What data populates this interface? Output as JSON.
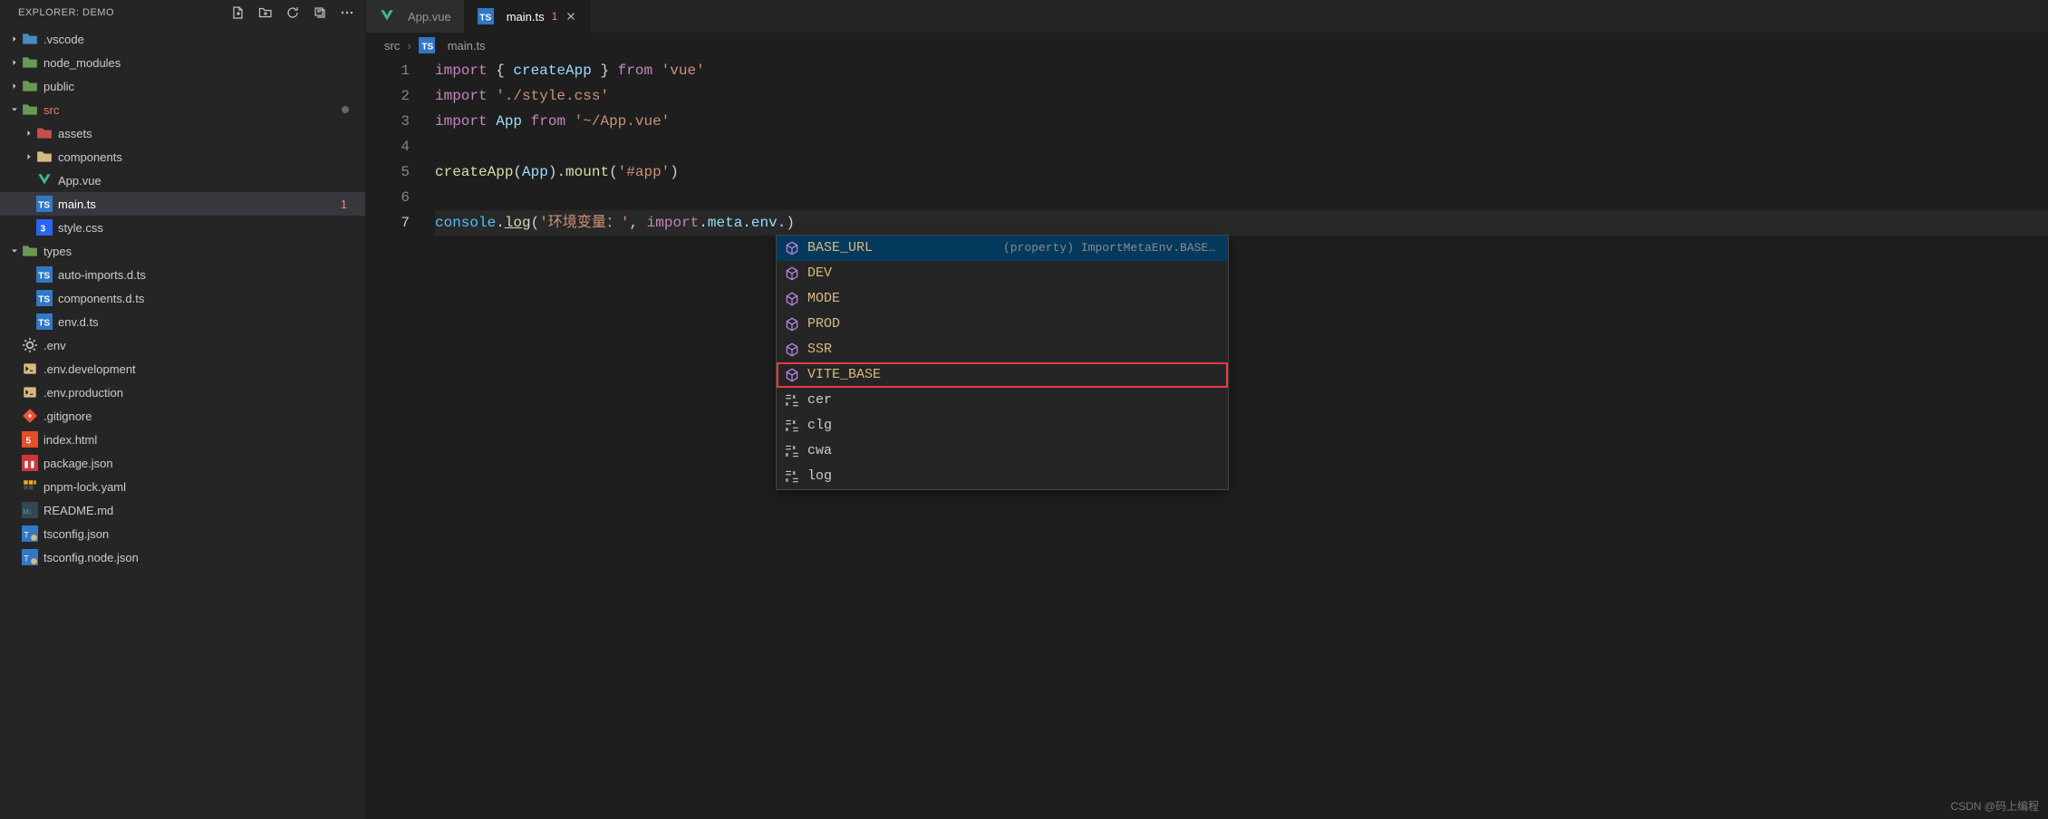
{
  "explorer": {
    "title": "EXPLORER: DEMO",
    "tree": [
      {
        "label": ".vscode",
        "depth": 0,
        "kind": "folder",
        "open": false,
        "icon": "folder-blue"
      },
      {
        "label": "node_modules",
        "depth": 0,
        "kind": "folder",
        "open": false,
        "icon": "folder-green"
      },
      {
        "label": "public",
        "depth": 0,
        "kind": "folder",
        "open": false,
        "icon": "folder-green"
      },
      {
        "label": "src",
        "depth": 0,
        "kind": "folder",
        "open": true,
        "icon": "folder-green",
        "modified": true,
        "cls": "src"
      },
      {
        "label": "assets",
        "depth": 1,
        "kind": "folder",
        "open": false,
        "icon": "folder-red"
      },
      {
        "label": "components",
        "depth": 1,
        "kind": "folder",
        "open": false,
        "icon": "folder-yellow"
      },
      {
        "label": "App.vue",
        "depth": 1,
        "kind": "file",
        "icon": "vue"
      },
      {
        "label": "main.ts",
        "depth": 1,
        "kind": "file",
        "icon": "ts",
        "selected": true,
        "badge": "1"
      },
      {
        "label": "style.css",
        "depth": 1,
        "kind": "file",
        "icon": "css"
      },
      {
        "label": "types",
        "depth": 0,
        "kind": "folder",
        "open": true,
        "icon": "folder-green"
      },
      {
        "label": "auto-imports.d.ts",
        "depth": 1,
        "kind": "file",
        "icon": "ts"
      },
      {
        "label": "components.d.ts",
        "depth": 1,
        "kind": "file",
        "icon": "ts"
      },
      {
        "label": "env.d.ts",
        "depth": 1,
        "kind": "file",
        "icon": "ts"
      },
      {
        "label": ".env",
        "depth": 0,
        "kind": "file",
        "icon": "gear"
      },
      {
        "label": ".env.development",
        "depth": 0,
        "kind": "file",
        "icon": "env"
      },
      {
        "label": ".env.production",
        "depth": 0,
        "kind": "file",
        "icon": "env"
      },
      {
        "label": ".gitignore",
        "depth": 0,
        "kind": "file",
        "icon": "git"
      },
      {
        "label": "index.html",
        "depth": 0,
        "kind": "file",
        "icon": "html"
      },
      {
        "label": "package.json",
        "depth": 0,
        "kind": "file",
        "icon": "npm"
      },
      {
        "label": "pnpm-lock.yaml",
        "depth": 0,
        "kind": "file",
        "icon": "pnpm"
      },
      {
        "label": "README.md",
        "depth": 0,
        "kind": "file",
        "icon": "md"
      },
      {
        "label": "tsconfig.json",
        "depth": 0,
        "kind": "file",
        "icon": "tsconf"
      },
      {
        "label": "tsconfig.node.json",
        "depth": 0,
        "kind": "file",
        "icon": "tsconf"
      }
    ]
  },
  "tabs": [
    {
      "label": "App.vue",
      "icon": "vue",
      "active": false
    },
    {
      "label": "main.ts",
      "icon": "ts",
      "active": true,
      "errors": "1",
      "close": true
    }
  ],
  "breadcrumbs": {
    "seg1": "src",
    "seg2": "main.ts",
    "seg2icon": "ts"
  },
  "code": {
    "lines": [
      {
        "n": "1",
        "tokens": [
          [
            "kw",
            "import"
          ],
          [
            "punc",
            " { "
          ],
          [
            "id",
            "createApp"
          ],
          [
            "punc",
            " } "
          ],
          [
            "kw",
            "from"
          ],
          [
            "punc",
            " "
          ],
          [
            "str",
            "'vue'"
          ]
        ]
      },
      {
        "n": "2",
        "tokens": [
          [
            "kw",
            "import"
          ],
          [
            "punc",
            " "
          ],
          [
            "str",
            "'./style.css'"
          ]
        ]
      },
      {
        "n": "3",
        "tokens": [
          [
            "kw",
            "import"
          ],
          [
            "punc",
            " "
          ],
          [
            "id",
            "App"
          ],
          [
            "punc",
            " "
          ],
          [
            "kw",
            "from"
          ],
          [
            "punc",
            " "
          ],
          [
            "str",
            "'~/App.vue'"
          ]
        ]
      },
      {
        "n": "4",
        "tokens": []
      },
      {
        "n": "5",
        "tokens": [
          [
            "fn",
            "createApp"
          ],
          [
            "punc",
            "("
          ],
          [
            "id",
            "App"
          ],
          [
            "punc",
            ")."
          ],
          [
            "fn",
            "mount"
          ],
          [
            "punc",
            "("
          ],
          [
            "str",
            "'#app'"
          ],
          [
            "punc",
            ")"
          ]
        ]
      },
      {
        "n": "6",
        "tokens": []
      },
      {
        "n": "7",
        "cur": true,
        "tokens": [
          [
            "var",
            "console"
          ],
          [
            "punc",
            "."
          ],
          [
            "log",
            "log"
          ],
          [
            "punc",
            "("
          ],
          [
            "str",
            "'环境变量：'"
          ],
          [
            "punc",
            ", "
          ],
          [
            "kw",
            "import"
          ],
          [
            "punc",
            "."
          ],
          [
            "id",
            "meta"
          ],
          [
            "punc",
            "."
          ],
          [
            "id",
            "env"
          ],
          [
            "punc",
            ".)"
          ]
        ]
      }
    ]
  },
  "suggest": {
    "detail_hint": "(property) ImportMetaEnv.BASE_UR…",
    "items": [
      {
        "label": "BASE_URL",
        "kind": "prop",
        "selected": true,
        "detail": true
      },
      {
        "label": "DEV",
        "kind": "prop"
      },
      {
        "label": "MODE",
        "kind": "prop"
      },
      {
        "label": "PROD",
        "kind": "prop"
      },
      {
        "label": "SSR",
        "kind": "prop"
      },
      {
        "label": "VITE_BASE",
        "kind": "prop",
        "highlight": true
      },
      {
        "label": "cer",
        "kind": "snippet"
      },
      {
        "label": "clg",
        "kind": "snippet"
      },
      {
        "label": "cwa",
        "kind": "snippet"
      },
      {
        "label": "log",
        "kind": "snippet"
      }
    ]
  },
  "watermark": "CSDN @码上编程"
}
